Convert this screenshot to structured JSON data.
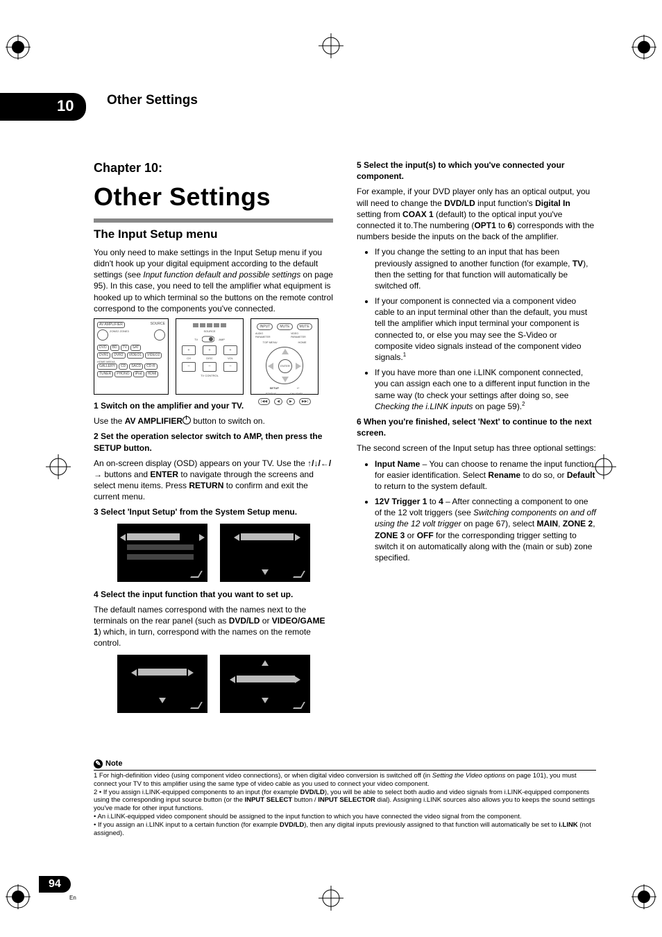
{
  "header": {
    "chapter_number": "10",
    "chapter_tab": "10",
    "chapter_header": "Other Settings",
    "chapter_label": "Chapter 10:",
    "chapter_title": "Other Settings"
  },
  "left": {
    "h2": "The Input Setup menu",
    "intro_a": "You only need to make settings in the Input Setup menu if you didn't hook up your digital equipment according to the default settings (see ",
    "intro_i": "Input function default and possible settings",
    "intro_b": " on page 95). In this case, you need to tell the amplifier what equipment is hooked up to which terminal so the buttons on the remote control correspond to the components you've connected.",
    "step1_head": "1    Switch on the amplifier and your TV.",
    "step1_a": "Use the ",
    "step1_bold": "AV AMPLIFIER",
    "step1_b": " button to switch on.",
    "step2_head": "2    Set the operation selector switch to AMP, then press the SETUP button.",
    "step2_a": "An on-screen display (OSD) appears on your TV. Use the ",
    "step2_arrows": "↑/↓/←/→",
    "step2_b": " buttons and ",
    "step2_bold1": "ENTER",
    "step2_c": " to navigate through the screens and select menu items. Press ",
    "step2_bold2": "RETURN",
    "step2_d": " to confirm and exit the current menu.",
    "step3_head": "3    Select 'Input Setup' from the System Setup menu.",
    "step4_head": "4    Select the input function that you want to set up.",
    "step4_a": "The default names correspond with the names next to the terminals on the rear panel (such as ",
    "step4_bold1": "DVD/LD",
    "step4_b": " or ",
    "step4_bold2": "VIDEO/GAME 1",
    "step4_c": ") which, in turn, correspond with the names on the remote control.",
    "remote_labels": {
      "av_amp": "AV AMPLIFIER",
      "source": "SOURCE",
      "zones": "ZONE2  ZONE3",
      "row1": [
        "DVD",
        "BD",
        "TV",
        "SAT"
      ],
      "row2": [
        "DVR1",
        "DVR2",
        "VIDEO1",
        "VIDEO2"
      ],
      "home": "HOME MEDIA",
      "row3": [
        "GALLERY",
        "CD",
        "SACD",
        "CD-R"
      ],
      "row4": [
        "TUNER",
        "PHONO",
        "iPod",
        "HDMI"
      ],
      "mid_top": "SOURCE",
      "mid_tv": "TV",
      "mid_amp": "AMP",
      "ch": "CH",
      "vol": "VOL",
      "disc": "DISC",
      "tvcontrol": "TV CONTROL",
      "input": "INPUT",
      "mute": "MUTE",
      "param": "AUDIO PARAMETER",
      "video_param": "VIDEO PARAMETER",
      "topmenu": "TOP MENU",
      "home2": "HOME",
      "setup": "SETUP",
      "return": "RETURN",
      "enter": "ENTER",
      "status": "STATUS",
      "chlevel": "CH LEVEL"
    }
  },
  "right": {
    "step5_head": "5    Select the input(s) to which you've connected your component.",
    "step5_a": "For example, if your DVD player only has an optical output, you will need to change the ",
    "step5_bold1": "DVD/LD",
    "step5_b": " input function's ",
    "step5_bold2": "Digital In",
    "step5_c": " setting from ",
    "step5_bold3": "COAX 1",
    "step5_d": " (default) to the optical input you've connected it to.The numbering (",
    "step5_bold4": "OPT1",
    "step5_e": " to ",
    "step5_bold5": "6",
    "step5_f": ") corresponds with the numbers beside the inputs on the back of the amplifier.",
    "bul1_a": "If you change the setting to an input that has been previously assigned to another function (for example, ",
    "bul1_bold": "TV",
    "bul1_b": "), then the setting for that function will automatically be switched off.",
    "bul2": "If your component is connected via a component video cable to an input terminal other than the default, you must tell the amplifier which input terminal your component is connected to, or else you may see the S-Video or composite video signals instead of the component video signals.",
    "bul2_sup": "1",
    "bul3_a": "If you have more than one i.LINK component connected, you can assign each one to a different input function in the same way (to check your settings after doing so, see ",
    "bul3_i": "Checking the i.LINK inputs",
    "bul3_b": " on page 59).",
    "bul3_sup": "2",
    "step6_head": "6    When you're finished, select 'Next' to continue to the next screen.",
    "step6_body": "The second screen of the Input setup has three optional settings:",
    "bul4_bold": "Input Name",
    "bul4_a": " – You can choose to rename the input function for easier identification. Select ",
    "bul4_bold2": "Rename",
    "bul4_b": " to do so, or ",
    "bul4_bold3": "Default",
    "bul4_c": " to return to the system default.",
    "bul5_bold": "12V Trigger 1",
    "bul5_a": " to ",
    "bul5_bold2": "4",
    "bul5_b": " – After connecting a component to one of the 12 volt triggers (see ",
    "bul5_i": "Switching components on and off using the 12 volt trigger",
    "bul5_c": " on page 67), select ",
    "bul5_bold3": "MAIN",
    "bul5_d": ", ",
    "bul5_bold4": "ZONE 2",
    "bul5_e": ", ",
    "bul5_bold5": "ZONE 3",
    "bul5_f": " or ",
    "bul5_bold6": "OFF",
    "bul5_g": " for the corresponding trigger setting to switch it on automatically along with the (main or sub) zone specified."
  },
  "notes": {
    "label": "Note",
    "n1_a": "1  For high-definition video (using component video connections), or when digital video conversion is switched off (in ",
    "n1_i": "Setting the Video options",
    "n1_b": " on page 101), you must connect your TV to this amplifier using the same type of video cable as you used to connect your video component.",
    "n2_a": "2  • If you assign i.LINK-equipped components to an input (for example ",
    "n2_bold1": "DVD/LD",
    "n2_b": "), you will be able to select both audio and video signals from i.LINK-equipped components using the corresponding input source button (or the ",
    "n2_bold2": "INPUT SELECT",
    "n2_c": " button / ",
    "n2_bold3": "INPUT SELECTOR",
    "n2_d": " dial). Assigning i.LINK sources also allows you to keeps the sound settings you've made for other input functions.",
    "n3": "    • An i.LINK-equipped video component should be assigned to the input function to which you have connected the video signal from the component.",
    "n4_a": "    • If you assign an i.LINK input to a certain function (for example ",
    "n4_bold1": "DVD/LD",
    "n4_b": "), then any digital inputs previously assigned to that function will automatically be set to ",
    "n4_bold2": "i.LINK",
    "n4_c": " (not assigned)."
  },
  "footer": {
    "page": "94",
    "lang": "En"
  }
}
